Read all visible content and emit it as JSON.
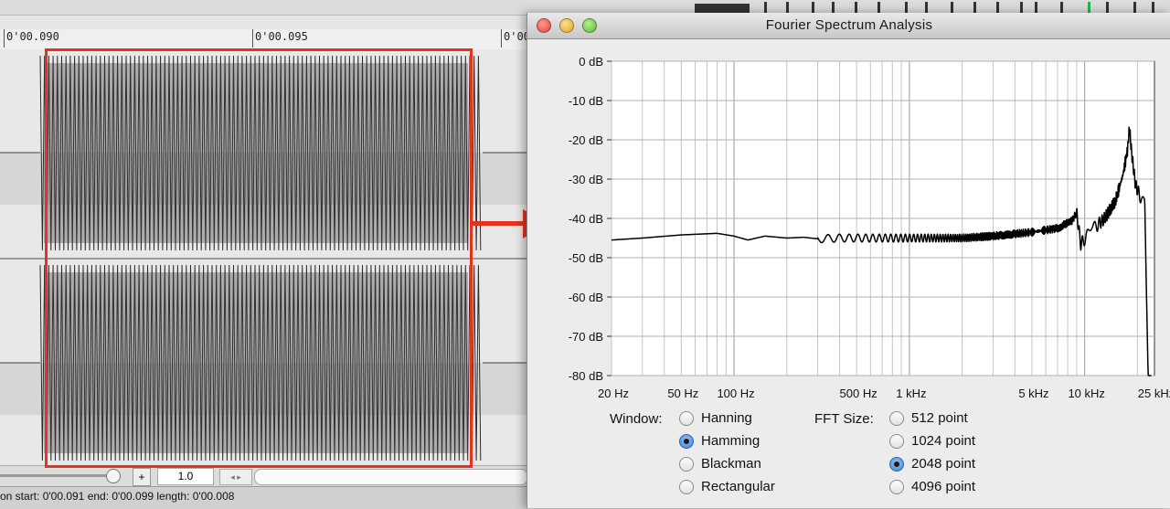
{
  "editor": {
    "timeline_ticks": [
      "0'00.090",
      "0'00.095",
      "0'00"
    ],
    "zoom_in_icon": "+",
    "zoom_value": "1.0",
    "scroll_arrows": "◂ ▸",
    "status": "on start: 0'00.091 end: 0'00.099 length: 0'00.008"
  },
  "spectrum_window": {
    "title": "Fourier Spectrum Analysis",
    "icons": {
      "close": "close-icon",
      "minimize": "minimize-icon",
      "zoom": "zoom-icon"
    },
    "window_label": "Window:",
    "window_options": [
      {
        "label": "Hanning",
        "checked": false
      },
      {
        "label": "Hamming",
        "checked": true
      },
      {
        "label": "Blackman",
        "checked": false
      },
      {
        "label": "Rectangular",
        "checked": false
      }
    ],
    "fft_label": "FFT Size:",
    "fft_options": [
      {
        "label": "512 point",
        "checked": false
      },
      {
        "label": "1024 point",
        "checked": false
      },
      {
        "label": "2048 point",
        "checked": true
      },
      {
        "label": "4096 point",
        "checked": false
      }
    ]
  },
  "chart_data": {
    "type": "line",
    "x_scale": "log",
    "xlim_hz": [
      20,
      25000
    ],
    "ylim_db": [
      -80,
      0
    ],
    "grid": true,
    "x_tick_labels": [
      {
        "hz": 20,
        "label": "20 Hz"
      },
      {
        "hz": 50,
        "label": "50 Hz"
      },
      {
        "hz": 100,
        "label": "100 Hz"
      },
      {
        "hz": 500,
        "label": "500 Hz"
      },
      {
        "hz": 1000,
        "label": "1 kHz"
      },
      {
        "hz": 5000,
        "label": "5 kHz"
      },
      {
        "hz": 10000,
        "label": "10 kHz"
      },
      {
        "hz": 25000,
        "label": "25 kHz"
      }
    ],
    "y_tick_labels": [
      {
        "db": 0,
        "label": "0 dB"
      },
      {
        "db": -10,
        "label": "-10 dB"
      },
      {
        "db": -20,
        "label": "-20 dB"
      },
      {
        "db": -30,
        "label": "-30 dB"
      },
      {
        "db": -40,
        "label": "-40 dB"
      },
      {
        "db": -50,
        "label": "-50 dB"
      },
      {
        "db": -60,
        "label": "-60 dB"
      },
      {
        "db": -70,
        "label": "-70 dB"
      },
      {
        "db": -80,
        "label": "-80 dB"
      }
    ],
    "series": [
      {
        "x_hz": [
          20,
          30,
          50,
          80,
          100,
          120,
          150,
          200,
          250,
          300,
          400,
          500,
          700,
          1000,
          2000,
          3000,
          5000,
          7000,
          8500,
          9000,
          9500,
          11000,
          13000,
          15000,
          16500,
          17500,
          18000,
          18500,
          19500,
          21000,
          22000,
          23000,
          23500,
          24000
        ],
        "y_db": [
          -45.5,
          -45.0,
          -44.2,
          -43.8,
          -44.5,
          -45.5,
          -44.5,
          -45.0,
          -44.8,
          -45.2,
          -45.0,
          -45.0,
          -45.0,
          -45.0,
          -45.0,
          -44.5,
          -43.5,
          -42.5,
          -40.5,
          -38.5,
          -46.5,
          -43.0,
          -40.0,
          -35.5,
          -29.0,
          -23.0,
          -17.0,
          -23.0,
          -31.5,
          -35.0,
          -36.5,
          -80.0,
          -80.0,
          -80.0
        ],
        "ripple_start_hz": 300,
        "ripple_amplitude_db": 1.0
      }
    ]
  }
}
